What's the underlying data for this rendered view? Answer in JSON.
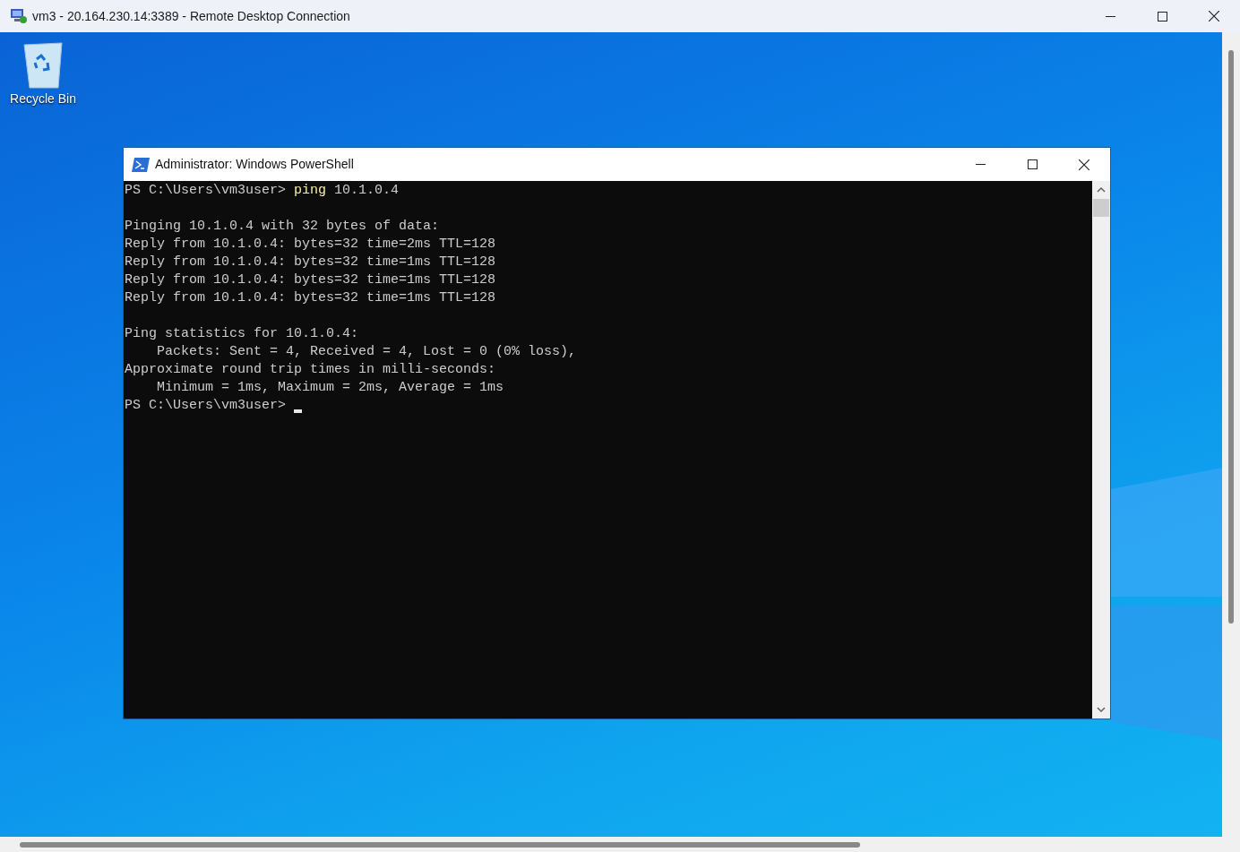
{
  "window": {
    "title": "vm3 - 20.164.230.14:3389 - Remote Desktop Connection"
  },
  "desktop_icons": [
    {
      "label": "Recycle Bin"
    }
  ],
  "powershell": {
    "title": "Administrator: Windows PowerShell",
    "lines": [
      {
        "kind": "prompt",
        "prompt": "PS C:\\Users\\vm3user>",
        "command": "ping",
        "args": "10.1.0.4",
        "cursor": false
      },
      {
        "kind": "blank"
      },
      {
        "kind": "output",
        "text": "Pinging 10.1.0.4 with 32 bytes of data:"
      },
      {
        "kind": "output",
        "text": "Reply from 10.1.0.4: bytes=32 time=2ms TTL=128"
      },
      {
        "kind": "output",
        "text": "Reply from 10.1.0.4: bytes=32 time=1ms TTL=128"
      },
      {
        "kind": "output",
        "text": "Reply from 10.1.0.4: bytes=32 time=1ms TTL=128"
      },
      {
        "kind": "output",
        "text": "Reply from 10.1.0.4: bytes=32 time=1ms TTL=128"
      },
      {
        "kind": "blank"
      },
      {
        "kind": "output",
        "text": "Ping statistics for 10.1.0.4:"
      },
      {
        "kind": "output",
        "text": "    Packets: Sent = 4, Received = 4, Lost = 0 (0% loss),"
      },
      {
        "kind": "output",
        "text": "Approximate round trip times in milli-seconds:"
      },
      {
        "kind": "output",
        "text": "    Minimum = 1ms, Maximum = 2ms, Average = 1ms"
      },
      {
        "kind": "prompt",
        "prompt": "PS C:\\Users\\vm3user>",
        "cursor": true
      }
    ]
  }
}
